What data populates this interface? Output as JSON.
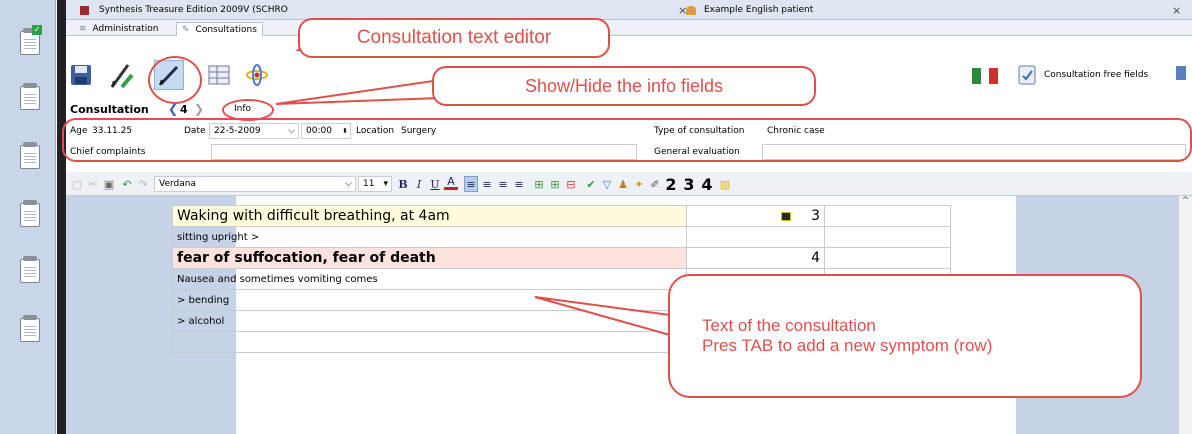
{
  "tabs": [
    {
      "title": "Synthesis Treasure Edition 2009V (SCHRO",
      "close": "×"
    },
    {
      "title": "Example English patient",
      "close": "×"
    }
  ],
  "module_tabs": {
    "administration": "Administration",
    "consultations": "Consultations"
  },
  "toolbar": {
    "free_fields_label": "Consultation free fields"
  },
  "consultation_bar": {
    "label": "Consultation",
    "prev": "❮",
    "number": "4",
    "next": "❯",
    "info_button": "Info"
  },
  "info_fields": {
    "age_label": "Age",
    "age_value": "33.11.25",
    "date_label": "Date",
    "date_value": "22-5-2009",
    "date_arrow": "⌵",
    "time_value": "00:00",
    "location_label": "Location",
    "location_value": "Surgery",
    "type_label": "Type of consultation",
    "type_value": "Chronic case",
    "chief_label": "Chief complaints",
    "chief_value": "",
    "general_label": "General evaluation",
    "general_value": ""
  },
  "format_bar": {
    "font": "Verdana",
    "font_arrow": "⌵",
    "size": "11",
    "size_arrow": "▾",
    "bold": "B",
    "italic": "I",
    "underline": "U",
    "color": "A",
    "degree_1": "2",
    "degree_2": "3",
    "degree_3": "4"
  },
  "symptoms": [
    {
      "text": "Waking with difficult breathing, at 4am",
      "grade": "3",
      "style": "highlight"
    },
    {
      "text": "sitting upright >",
      "grade": "",
      "style": "normal"
    },
    {
      "text": "fear of suffocation, fear of death",
      "grade": "4",
      "style": "bold"
    },
    {
      "text": "Nausea and sometimes vomiting comes",
      "grade": "",
      "style": "normal"
    },
    {
      "text": "> bending",
      "grade": "",
      "style": "normal"
    },
    {
      "text": "> alcohol",
      "grade": "",
      "style": "normal"
    },
    {
      "text": "",
      "grade": "",
      "style": "normal"
    }
  ],
  "callouts": {
    "text_editor": "Consultation text editor",
    "info_fields": "Show/Hide the info fields",
    "text_line1": "Text of the consultation",
    "text_line2": "Pres TAB to add a new symptom (row)"
  },
  "colors": {
    "callout": "#e0504b",
    "row_highlight": "#fffbdb",
    "row_bold": "#fde2de",
    "editor_bg": "#c6d3e6"
  }
}
